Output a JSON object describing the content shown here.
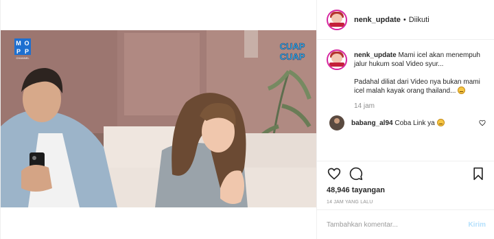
{
  "header": {
    "username": "nenk_update",
    "separator": "•",
    "follow_status": "Diikuti"
  },
  "media": {
    "logo_letters": [
      "M",
      "O",
      "P",
      "P"
    ],
    "logo_sub": "CHANNEL",
    "overlay_text_1": "CUAP",
    "overlay_text_2": "CUAP"
  },
  "caption": {
    "username": "nenk_update",
    "text_1": "Mami icel akan menempuh jalur hukum soal Video syur...",
    "text_2": "Padahal diliat dari Video nya bukan mami icel malah kayak orang thailand...",
    "emoji": "grimacing-face",
    "time": "14 jam"
  },
  "comment": {
    "username": "babang_al94",
    "text": "Coba Link ya",
    "emoji": "grinning-face"
  },
  "actions": {
    "views": "48,946 tayangan",
    "posted_ago": "14 JAM YANG LALU"
  },
  "add_comment": {
    "placeholder": "Tambahkan komentar...",
    "send_label": "Kirim"
  },
  "colors": {
    "text": "#262626",
    "muted": "#8e8e8e",
    "send_disabled": "#b2dffc",
    "border": "#efefef"
  }
}
